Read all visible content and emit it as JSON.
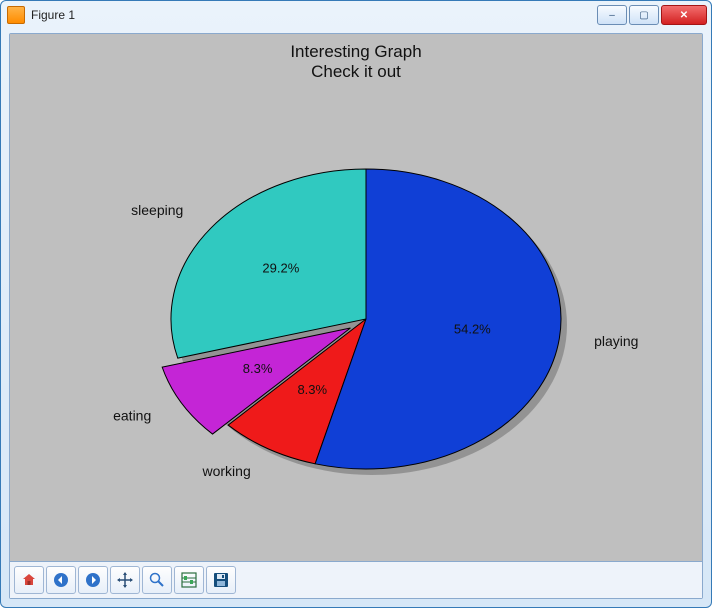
{
  "window": {
    "title": "Figure 1"
  },
  "chart_data": {
    "type": "pie",
    "title": "Interesting Graph",
    "subtitle": "Check it out",
    "series": [
      {
        "name": "sleeping",
        "value": 29.2,
        "pct_label": "29.2%",
        "color": "#30c9c0",
        "exploded": false
      },
      {
        "name": "eating",
        "value": 8.3,
        "pct_label": "8.3%",
        "color": "#c425d6",
        "exploded": true
      },
      {
        "name": "working",
        "value": 8.3,
        "pct_label": "8.3%",
        "color": "#ef1a1a",
        "exploded": false
      },
      {
        "name": "playing",
        "value": 54.2,
        "pct_label": "54.2%",
        "color": "#103fd6",
        "exploded": false
      }
    ],
    "start_angle_deg": 90,
    "direction": "counterclockwise",
    "shadow": true
  },
  "toolbar": {
    "home": "Home",
    "back": "Back",
    "forward": "Forward",
    "pan": "Pan",
    "zoom": "Zoom",
    "subplots": "Configure subplots",
    "save": "Save"
  },
  "win_controls": {
    "minimize": "–",
    "maximize": "▢",
    "close": "✕"
  }
}
